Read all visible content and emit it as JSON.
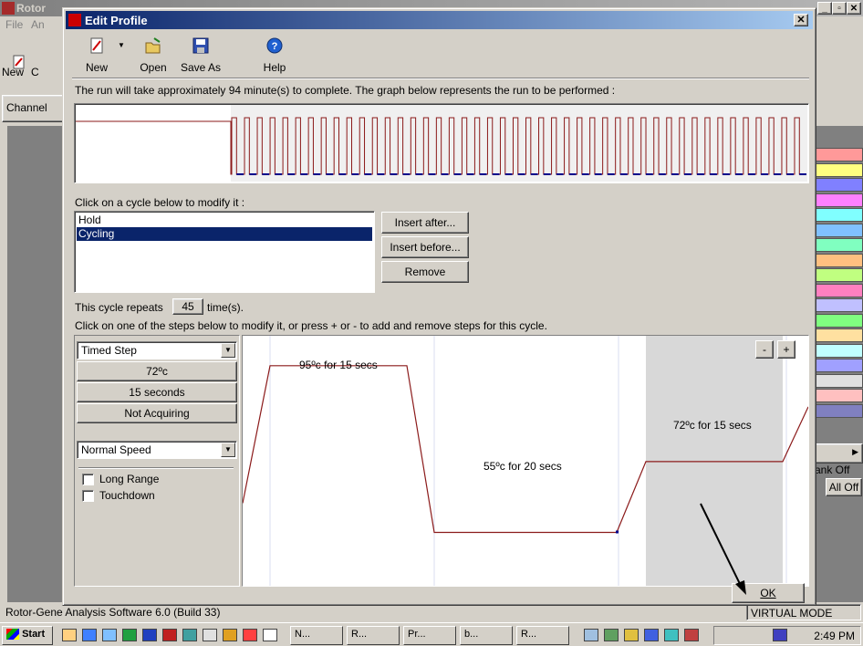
{
  "background_app": {
    "title": "Rotor",
    "menu": [
      "File",
      "An"
    ],
    "toolbar_new": "New",
    "toolbar_c": "C",
    "channel_label": "Channel",
    "status_left": "Rotor-Gene Analysis Software 6.0 (Build 33)",
    "status_right": "VIRTUAL MODE",
    "right_label_bank": "ank Off",
    "right_button_all_off": "All Off",
    "strip_colors": [
      "#ff9999",
      "#ffff80",
      "#8080ff",
      "#ff80ff",
      "#80ffff",
      "#80c0ff",
      "#80ffc0",
      "#ffc080",
      "#c0ff80",
      "#ff80c0",
      "#c0c0ff",
      "#80ff80",
      "#ffe0a0",
      "#c0ffff",
      "#a0a0ff",
      "#e0e0e0",
      "#ffc0c0",
      "#8080c0"
    ]
  },
  "dialog": {
    "title": "Edit Profile",
    "toolbar": {
      "new": "New",
      "open": "Open",
      "save_as": "Save As",
      "help": "Help"
    },
    "run_info": "The run will take approximately 94 minute(s) to complete. The graph below represents the run to be performed :",
    "cycle_prompt": "Click on a cycle below to modify it :",
    "cycles": [
      {
        "label": "Hold",
        "selected": false
      },
      {
        "label": "Cycling",
        "selected": true
      }
    ],
    "buttons": {
      "insert_after": "Insert after...",
      "insert_before": "Insert before...",
      "remove": "Remove",
      "minus": "-",
      "plus": "+",
      "ok": "OK"
    },
    "repeat_prefix": "This cycle repeats",
    "repeat_count": "45",
    "repeat_suffix": "time(s).",
    "steps_prompt": "Click on one of the steps below to modify it, or press + or - to add and remove steps for this cycle.",
    "step_panel": {
      "step_type": "Timed Step",
      "temperature": "72ºc",
      "duration": "15 seconds",
      "acquisition": "Not Acquiring",
      "speed": "Normal Speed",
      "long_range": "Long Range",
      "touchdown": "Touchdown"
    },
    "step_graph": {
      "steps": [
        {
          "label": "95ºc for 15 secs",
          "temp": 95
        },
        {
          "label": "55ºc for 20 secs",
          "temp": 55
        },
        {
          "label": "72ºc for 15 secs",
          "temp": 72
        }
      ]
    }
  },
  "taskbar": {
    "start": "Start",
    "tasks": [
      "N...",
      "R...",
      "Pr...",
      "b...",
      "R..."
    ],
    "clock": "2:49 PM"
  },
  "colors": {
    "title_active": "#0a246a",
    "profile_line": "#8b1a1a",
    "profile_dots": "#00008b"
  }
}
